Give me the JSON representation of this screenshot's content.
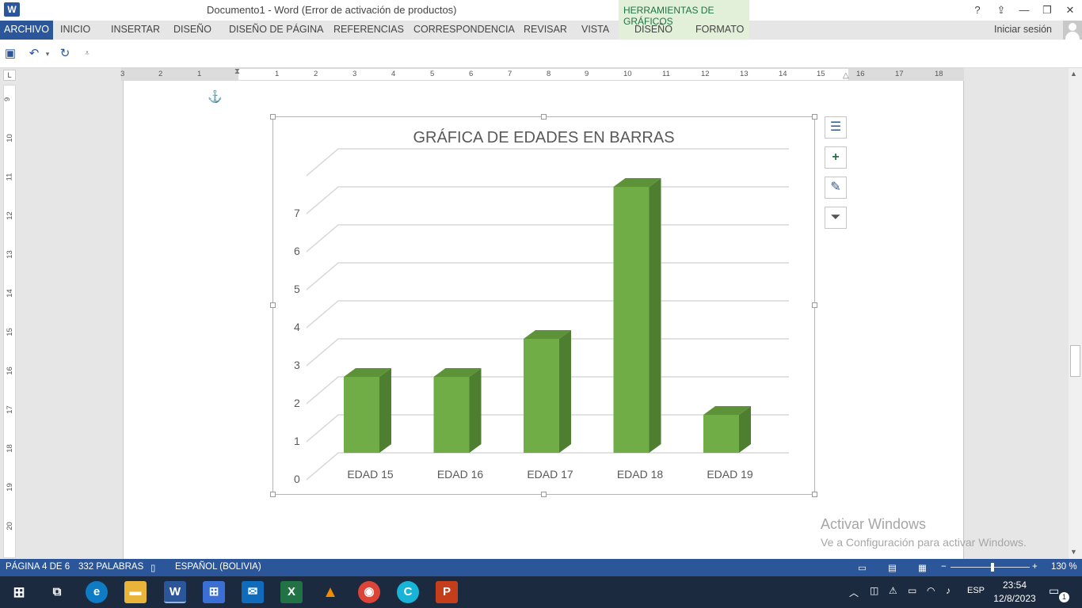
{
  "window": {
    "title": "Documento1 - Word (Error de activación de productos)",
    "help": "?",
    "word_logo": "W"
  },
  "ribbon": {
    "tabs": [
      "ARCHIVO",
      "INICIO",
      "INSERTAR",
      "DISEÑO",
      "DISEÑO DE PÁGINA",
      "REFERENCIAS",
      "CORRESPONDENCIA",
      "REVISAR",
      "VISTA"
    ],
    "context_group": "HERRAMIENTAS DE GRÁFICOS",
    "context_tabs": [
      "DISEÑO",
      "FORMATO"
    ],
    "signin": "Iniciar sesión"
  },
  "ruler": {
    "h_numbers": [
      "3",
      "2",
      "1",
      "1",
      "2",
      "3",
      "4",
      "5",
      "6",
      "7",
      "8",
      "9",
      "10",
      "11",
      "12",
      "13",
      "14",
      "15",
      "16",
      "17",
      "18"
    ],
    "v_numbers": [
      "9",
      "10",
      "11",
      "12",
      "13",
      "14",
      "15",
      "16",
      "17",
      "18",
      "19",
      "20"
    ]
  },
  "chart_data": {
    "type": "bar",
    "title": "GRÁFICA DE EDADES EN BARRAS",
    "categories": [
      "EDAD 15",
      "EDAD 16",
      "EDAD 17",
      "EDAD 18",
      "EDAD 19"
    ],
    "values": [
      2,
      2,
      3,
      7,
      1
    ],
    "ylim": [
      0,
      7
    ],
    "yticks": [
      "0",
      "1",
      "2",
      "3",
      "4",
      "5",
      "6",
      "7"
    ],
    "grid": true,
    "bar_color": "#70ad47",
    "bar_side_color": "#4e7f31",
    "bar_top_color": "#5d9238"
  },
  "watermark": {
    "line1": "Activar Windows",
    "line2": "Ve a Configuración para activar Windows."
  },
  "status": {
    "page": "PÁGINA 4 DE 6",
    "words": "332 PALABRAS",
    "language": "ESPAÑOL (BOLIVIA)",
    "zoom": "130 %",
    "minus": "−",
    "plus": "+"
  },
  "taskbar": {
    "lang": "ESP",
    "time": "23:54",
    "date": "12/8/2023",
    "notif_count": "1"
  },
  "colors": {
    "brand": "#2b579a",
    "context": "#e2efd9"
  }
}
